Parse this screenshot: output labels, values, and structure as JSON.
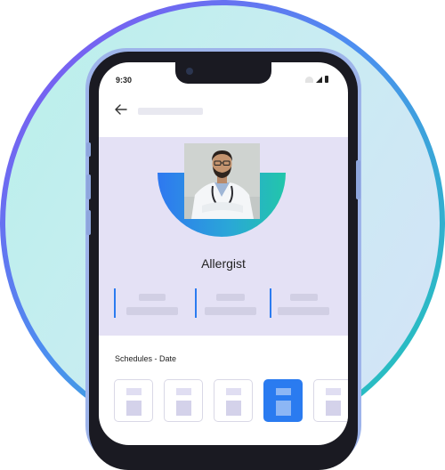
{
  "status_bar": {
    "time": "9:30"
  },
  "navigation": {
    "back_icon": "arrow-left-icon"
  },
  "profile": {
    "specialty": "Allergist",
    "avatar_icon": "doctor-portrait"
  },
  "schedules": {
    "label": "Schedules - Date",
    "selected_index": 3
  },
  "colors": {
    "accent": "#2A7BF0",
    "hero_background": "#E4E1F5",
    "gradient_start": "#2E78F0",
    "gradient_end": "#22C6AA"
  }
}
